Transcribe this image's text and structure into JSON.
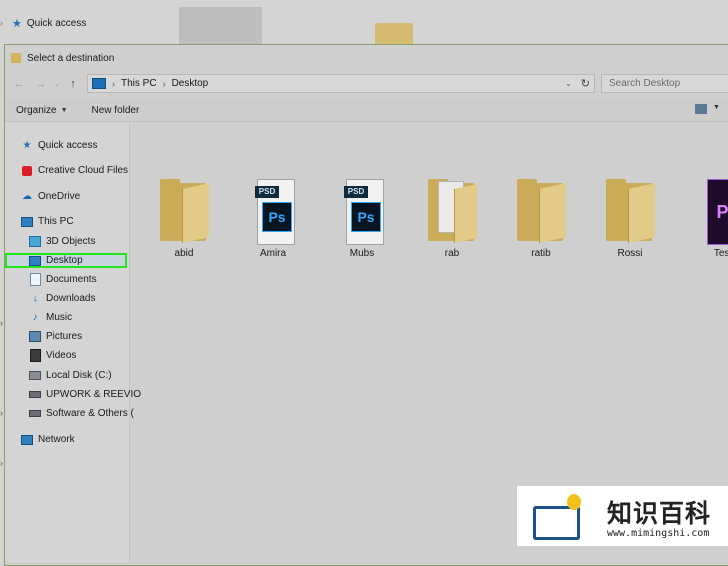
{
  "background_window": {
    "quick_access_label": "Quick access"
  },
  "dialog": {
    "title": "Select a destination",
    "address": {
      "crumbs": [
        "This PC",
        "Desktop"
      ]
    },
    "search": {
      "placeholder": "Search Desktop"
    },
    "toolbar": {
      "organize_label": "Organize",
      "new_folder_label": "New folder"
    },
    "nav": {
      "quick_access": "Quick access",
      "creative_cloud": "Creative Cloud Files",
      "onedrive": "OneDrive",
      "this_pc": "This PC",
      "objects_3d": "3D Objects",
      "desktop": "Desktop",
      "documents": "Documents",
      "downloads": "Downloads",
      "music": "Music",
      "pictures": "Pictures",
      "videos": "Videos",
      "local_disk": "Local Disk (C:)",
      "upwork": "UPWORK & REEVIO",
      "software": "Software & Others (",
      "network": "Network"
    },
    "files": [
      {
        "name": "abid",
        "type": "folder"
      },
      {
        "name": "Amira",
        "type": "psd"
      },
      {
        "name": "Mubs",
        "type": "psd"
      },
      {
        "name": "rab",
        "type": "folder-docs"
      },
      {
        "name": "ratib",
        "type": "folder"
      },
      {
        "name": "Rossi",
        "type": "folder"
      },
      {
        "name": "Test",
        "type": "premiere"
      }
    ],
    "psd_badge": "PSD",
    "ps_logo": "Ps",
    "pr_logo": "Pr"
  },
  "watermark": {
    "chinese": "知识百科",
    "url": "www.mimingshi.com"
  }
}
